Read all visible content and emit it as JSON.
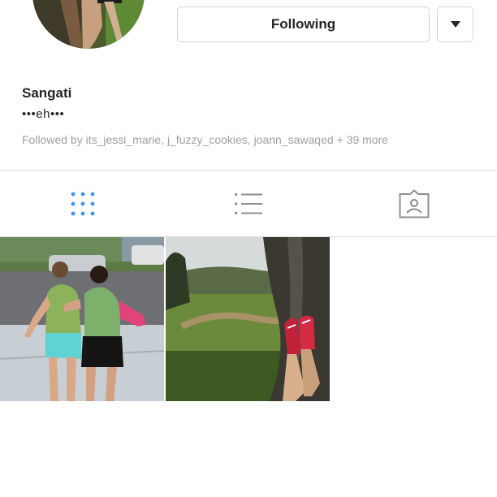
{
  "profile": {
    "name": "Sangati",
    "bio": "•••eh•••",
    "followed_by": "Followed by its_jessi_marie, j_fuzzy_cookies, joann_sawaqed + 39 more"
  },
  "actions": {
    "following_label": "Following",
    "dropdown_icon": "caret-down-icon"
  },
  "tabs": [
    {
      "name": "grid",
      "icon": "grid-icon",
      "active": true
    },
    {
      "name": "list",
      "icon": "list-icon",
      "active": false
    },
    {
      "name": "tagged",
      "icon": "tagged-icon",
      "active": false
    }
  ],
  "colors": {
    "active_tab": "#3897f0",
    "inactive_tab": "#8e8e8e",
    "text": "#262626",
    "secondary_text": "#a0a0a0",
    "border": "#dbdbdb"
  },
  "posts": [
    {
      "description": "two girls outdoors on a street"
    },
    {
      "description": "legs in red sneakers by a tree over a green valley"
    }
  ]
}
